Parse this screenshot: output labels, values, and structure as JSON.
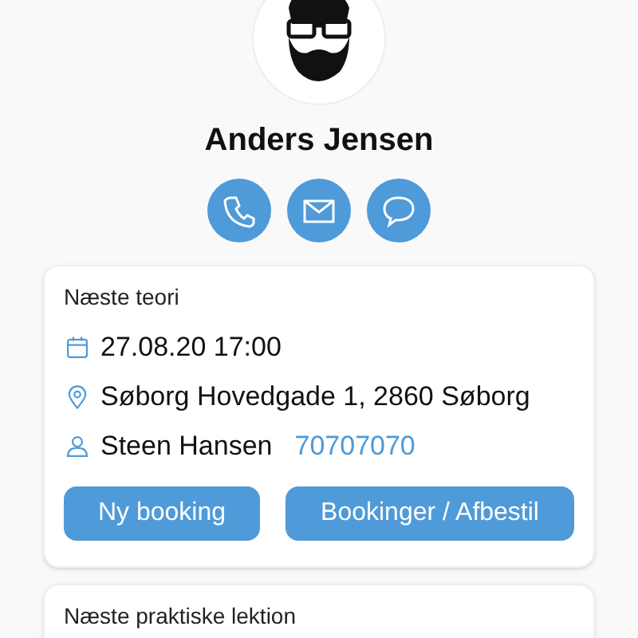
{
  "profile": {
    "name": "Anders Jensen"
  },
  "contact_actions": [
    {
      "kind": "phone"
    },
    {
      "kind": "email"
    },
    {
      "kind": "chat"
    }
  ],
  "cards": [
    {
      "title": "Næste teori",
      "details": [
        {
          "kind": "date",
          "text": "27.08.20 17:00"
        },
        {
          "kind": "location",
          "text": "Søborg Hovedgade 1, 2860 Søborg"
        },
        {
          "kind": "person",
          "text": "Steen Hansen",
          "link": "70707070"
        }
      ],
      "buttons": [
        "Ny booking",
        "Bookinger / Afbestil"
      ]
    },
    {
      "title": "Næste praktiske lektion"
    }
  ]
}
